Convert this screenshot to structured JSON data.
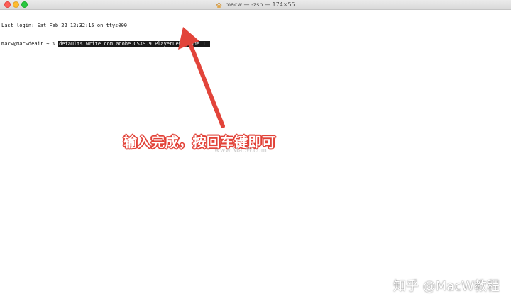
{
  "window": {
    "title": "macw — -zsh — 174×55",
    "icon": "home-folder-icon"
  },
  "terminal": {
    "last_login": "Last login: Sat Feb 22 13:32:15 on ttys000",
    "prompt": "macw@macwdeair ~ % ",
    "command": "defaults write com.adobe.CSXS.9 PlayerDebugMode 1"
  },
  "annotation": {
    "caption": "输入完成，按回车键即可",
    "arrow_color": "#e2443a",
    "faint_watermark": "www.MacW.com"
  },
  "watermark": {
    "text": "知乎 @MacW教程"
  },
  "colors": {
    "close": "#fe5f57",
    "minimize": "#febc2e",
    "maximize": "#28c840"
  }
}
